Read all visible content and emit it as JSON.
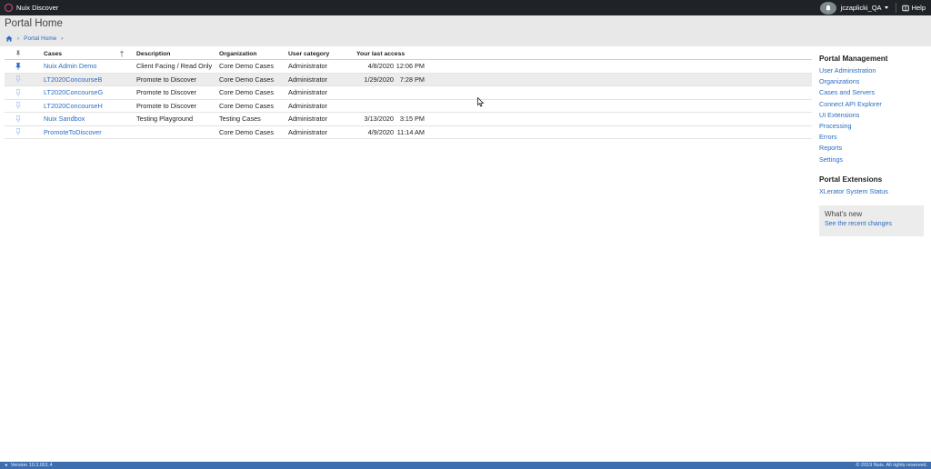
{
  "topbar": {
    "app_name": "Nuix Discover",
    "user_name": "jczaplicki_QA",
    "help_label": "Help"
  },
  "header": {
    "title": "Portal Home",
    "breadcrumb": [
      "Portal Home"
    ]
  },
  "table": {
    "columns": {
      "cases": "Cases",
      "description": "Description",
      "organization": "Organization",
      "user_category": "User category",
      "last_access": "Your last access"
    },
    "rows": [
      {
        "pinned": true,
        "case": "Nuix Admin Demo",
        "description": "Client Facing / Read Only",
        "organization": "Core Demo Cases",
        "user_category": "Administrator",
        "date": "4/8/2020",
        "time": "12:06 PM"
      },
      {
        "pinned": false,
        "case": "LT2020ConcourseB",
        "description": "Promote to Discover",
        "organization": "Core Demo Cases",
        "user_category": "Administrator",
        "date": "1/29/2020",
        "time": "7:28 PM"
      },
      {
        "pinned": false,
        "case": "LT2020ConcourseG",
        "description": "Promote to Discover",
        "organization": "Core Demo Cases",
        "user_category": "Administrator",
        "date": "",
        "time": ""
      },
      {
        "pinned": false,
        "case": "LT2020ConcourseH",
        "description": "Promote to Discover",
        "organization": "Core Demo Cases",
        "user_category": "Administrator",
        "date": "",
        "time": ""
      },
      {
        "pinned": false,
        "case": "Nuix Sandbox",
        "description": "Testing Playground",
        "organization": "Testing Cases",
        "user_category": "Administrator",
        "date": "3/13/2020",
        "time": "3:15 PM"
      },
      {
        "pinned": false,
        "case": "PromoteToDiscover",
        "description": "",
        "organization": "Core Demo Cases",
        "user_category": "Administrator",
        "date": "4/9/2020",
        "time": "11:14 AM"
      }
    ]
  },
  "sidebar": {
    "management_heading": "Portal Management",
    "management_links": [
      "User Administration",
      "Organizations",
      "Cases and Servers",
      "Connect API Explorer",
      "UI Extensions",
      "Processing",
      "Errors",
      "Reports",
      "Settings"
    ],
    "extensions_heading": "Portal Extensions",
    "extensions_links": [
      "XLerator System Status"
    ],
    "whats_new": {
      "title": "What's new",
      "link": "See the recent changes"
    }
  },
  "footer": {
    "version": "Version 10.3.001.4",
    "copyright": "© 2019 Nuix. All rights reserved."
  },
  "colors": {
    "topbar": "#1f2328",
    "link": "#2a6cc4",
    "footer": "#3d6fb0",
    "highlight_row": "#ececec"
  }
}
